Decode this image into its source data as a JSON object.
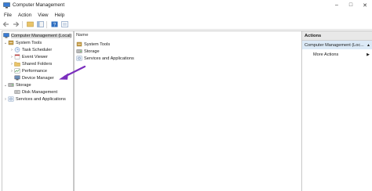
{
  "window": {
    "title": "Computer Management",
    "controls": {
      "minimize": "–",
      "maximize": "□",
      "close": "✕"
    }
  },
  "menu": [
    "File",
    "Action",
    "View",
    "Help"
  ],
  "toolbar": {
    "buttons": [
      "back-icon",
      "forward-icon",
      "up-icon",
      "show-hide-tree-icon",
      "help-icon",
      "properties-icon"
    ]
  },
  "tree": {
    "root": "Computer Management (Local)",
    "system_tools": "System Tools",
    "task_scheduler": "Task Scheduler",
    "event_viewer": "Event Viewer",
    "shared_folders": "Shared Folders",
    "performance": "Performance",
    "device_manager": "Device Manager",
    "storage": "Storage",
    "disk_management": "Disk Management",
    "services": "Services and Applications"
  },
  "center": {
    "column_header": "Name",
    "rows": [
      "System Tools",
      "Storage",
      "Services and Applications"
    ]
  },
  "actions": {
    "header": "Actions",
    "section": "Computer Management (Loc...",
    "section_arrow": "▲",
    "more": "More Actions",
    "more_arrow": "▶"
  },
  "colors": {
    "accent": "#7b2fbe",
    "actions_section_bg": "#dceaf7"
  }
}
